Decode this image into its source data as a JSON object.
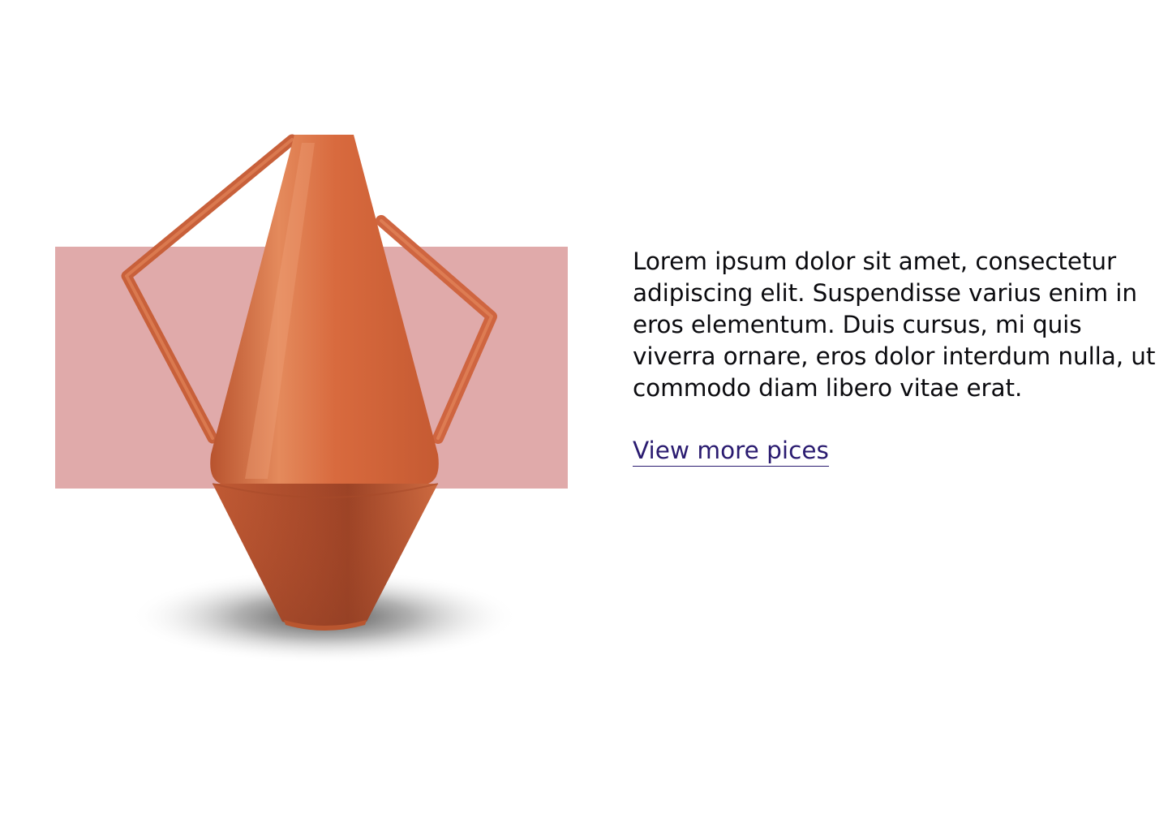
{
  "colors": {
    "backdrop": "#e0aaaa",
    "vase": "#d0643a",
    "text": "#0b0b0f",
    "link": "#2a1b70"
  },
  "hero": {
    "image_icon": "vase-icon"
  },
  "content": {
    "description_lines": [
      "Lorem ipsum dolor sit amet, consectetur",
      "adipiscing elit. Suspendisse varius enim in",
      "eros elementum. Duis cursus, mi quis",
      "viverra ornare, eros dolor interdum nulla, ut",
      "commodo diam libero vitae erat."
    ],
    "link_label": "View more pices"
  }
}
